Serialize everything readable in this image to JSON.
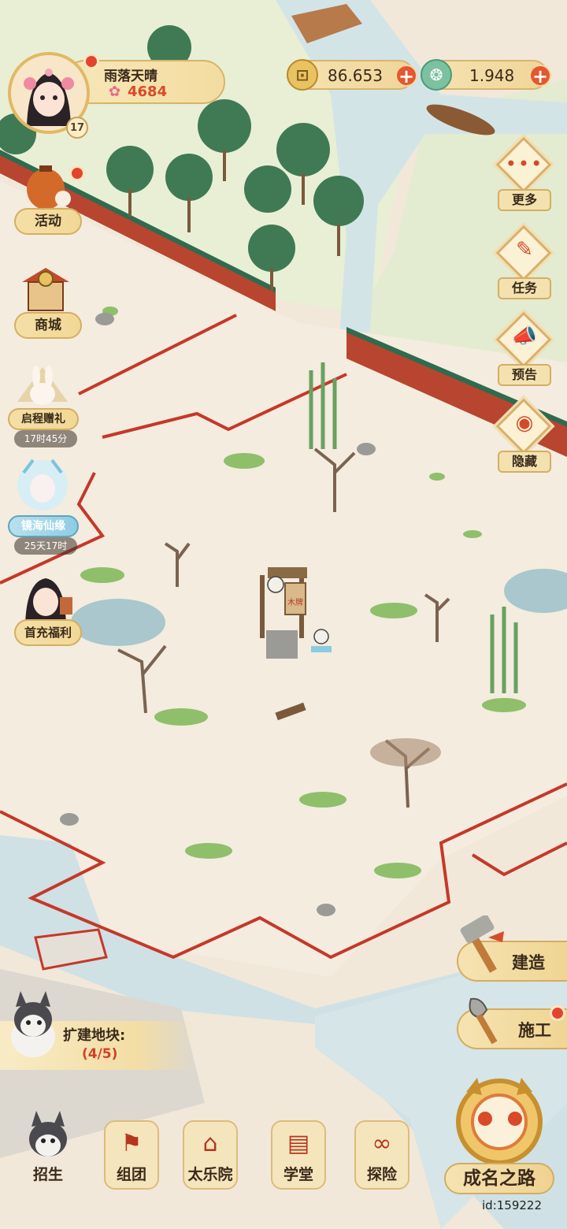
{
  "player": {
    "name": "雨落天晴",
    "score": "4684",
    "level": "17"
  },
  "resources": {
    "coins": "86.653",
    "jade": "1.948"
  },
  "left_menu": {
    "activity": "活动",
    "shop": "商城",
    "journey_gift": "启程赠礼",
    "journey_timer": "17时45分",
    "mirror_sea": "镜海仙缘",
    "mirror_timer": "25天17时",
    "first_charge": "首充福利"
  },
  "right_menu": {
    "more": "更多",
    "tasks": "任务",
    "notice": "预告",
    "hide": "隐藏"
  },
  "actions": {
    "build": "建造",
    "construct": "施工"
  },
  "expand": {
    "title": "扩建地块:",
    "count": "(4/5)"
  },
  "scene": {
    "signpost": "木牌"
  },
  "bottom_nav": {
    "recruit": "招生",
    "team": "组团",
    "music_academy": "太乐院",
    "school": "学堂",
    "explore": "探险",
    "path_to_fame": "成名之路"
  },
  "user_id": "id:159222",
  "colors": {
    "ground": "#f1e8da",
    "grass": "#e7efd4",
    "water": "#c9dfe3",
    "wall_red": "#b8452f",
    "fence_red": "#c5382a",
    "accent_gold": "#d7b46a"
  }
}
